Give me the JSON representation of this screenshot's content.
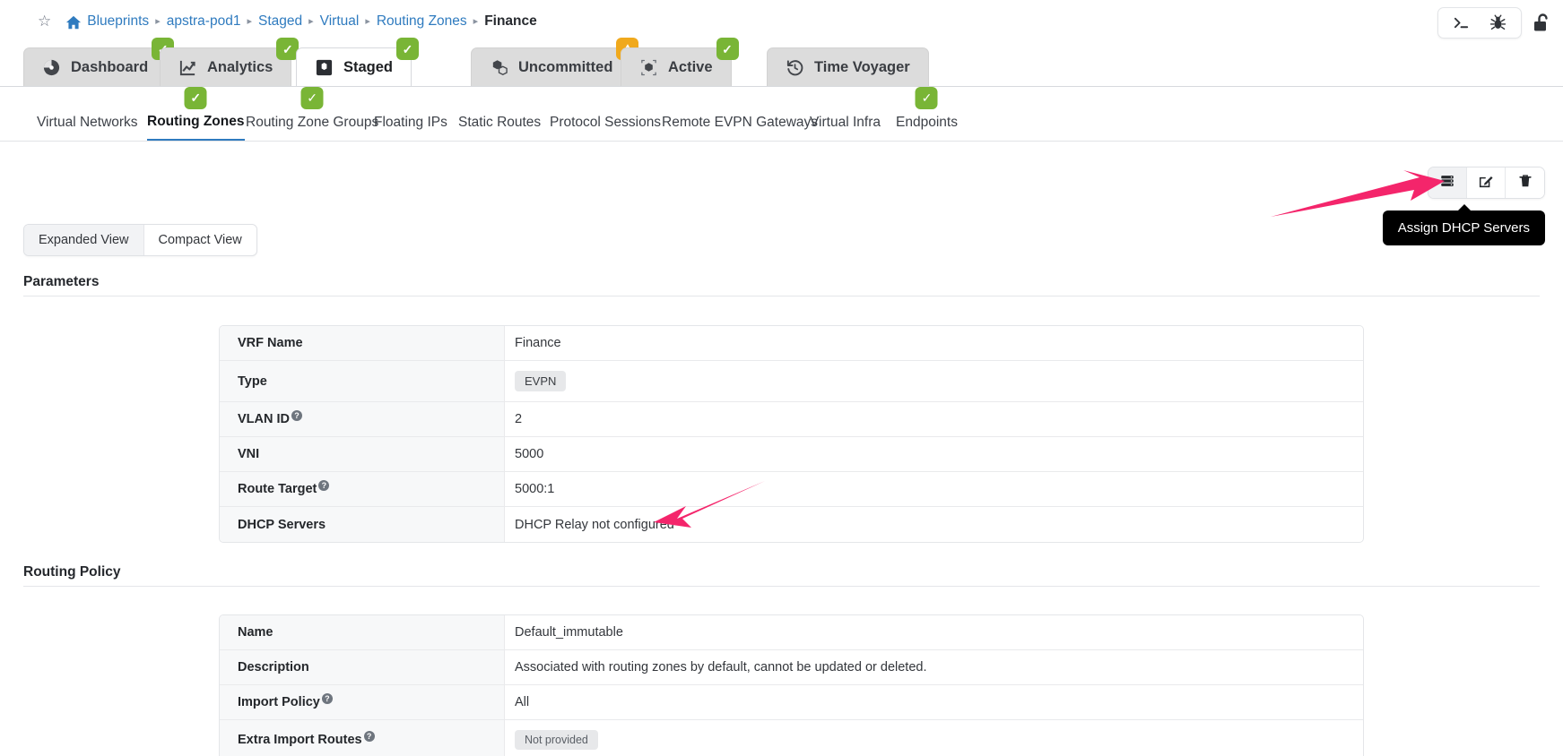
{
  "breadcrumb": {
    "items": [
      {
        "label": "Blueprints",
        "link": true
      },
      {
        "label": "apstra-pod1",
        "link": true
      },
      {
        "label": "Staged",
        "link": true
      },
      {
        "label": "Virtual",
        "link": true
      },
      {
        "label": "Routing Zones",
        "link": true
      },
      {
        "label": "Finance",
        "link": false
      }
    ],
    "separator": "▸"
  },
  "topbar": {
    "terminal_icon": "terminal-icon",
    "bug_icon": "bug-icon",
    "lock_icon": "unlocked-padlock-icon"
  },
  "tabs": [
    {
      "label": "Dashboard",
      "icon": "dashboard-gauge-icon",
      "badge": "ok",
      "selected": false
    },
    {
      "label": "Analytics",
      "icon": "analytics-chart-icon",
      "badge": "ok",
      "selected": false
    },
    {
      "label": "Staged",
      "icon": "staged-box-icon",
      "badge": "ok",
      "selected": true
    },
    {
      "label": "Uncommitted",
      "icon": "uncommitted-cubes-icon",
      "badge": "warn",
      "selected": false
    },
    {
      "label": "Active",
      "icon": "active-cube-icon",
      "badge": "ok",
      "selected": false
    },
    {
      "label": "Time Voyager",
      "icon": "time-voyager-clock-icon",
      "badge": null,
      "selected": false
    }
  ],
  "subtabs": [
    {
      "label": "Virtual Networks",
      "badge": false,
      "selected": false
    },
    {
      "label": "Routing Zones",
      "badge": true,
      "selected": true
    },
    {
      "label": "Routing Zone Groups",
      "badge": true,
      "selected": false
    },
    {
      "label": "Floating IPs",
      "badge": false,
      "selected": false
    },
    {
      "label": "Static Routes",
      "badge": false,
      "selected": false
    },
    {
      "label": "Protocol Sessions",
      "badge": false,
      "selected": false
    },
    {
      "label": "Remote EVPN Gateways",
      "badge": false,
      "selected": false
    },
    {
      "label": "Virtual Infra",
      "badge": false,
      "selected": false
    },
    {
      "label": "Endpoints",
      "badge": true,
      "selected": false
    }
  ],
  "actionbar": {
    "assign_dhcp": {
      "name": "assign-dhcp-servers-button",
      "icon": "server-stack-icon"
    },
    "edit": {
      "name": "edit-button",
      "icon": "pencil-square-icon"
    },
    "delete": {
      "name": "delete-button",
      "icon": "trash-icon"
    },
    "tooltip": "Assign DHCP Servers"
  },
  "view_switch": {
    "options": [
      {
        "label": "Expanded View",
        "selected": true
      },
      {
        "label": "Compact View",
        "selected": false
      }
    ]
  },
  "parameters": {
    "title": "Parameters",
    "rows": [
      {
        "key": "VRF Name",
        "help": false,
        "value": "Finance",
        "type": "text"
      },
      {
        "key": "Type",
        "help": false,
        "value": "EVPN",
        "type": "pill"
      },
      {
        "key": "VLAN ID",
        "help": true,
        "value": "2",
        "type": "text"
      },
      {
        "key": "VNI",
        "help": false,
        "value": "5000",
        "type": "text"
      },
      {
        "key": "Route Target",
        "help": true,
        "value": "5000:1",
        "type": "text"
      },
      {
        "key": "DHCP Servers",
        "help": false,
        "value": "DHCP Relay not configured",
        "type": "text"
      }
    ]
  },
  "routing_policy": {
    "title": "Routing Policy",
    "rows": [
      {
        "key": "Name",
        "help": false,
        "value": "Default_immutable",
        "type": "text"
      },
      {
        "key": "Description",
        "help": false,
        "value": "Associated with routing zones by default, cannot be updated or deleted.",
        "type": "text"
      },
      {
        "key": "Import Policy",
        "help": true,
        "value": "All",
        "type": "text"
      },
      {
        "key": "Extra Import Routes",
        "help": true,
        "value": "Not provided",
        "type": "pill"
      }
    ]
  },
  "annotations": {
    "arrow_color": "#f4256b",
    "arrow_to_toolbar": "points-right-to-assign-dhcp-button",
    "arrow_to_dhcp_value": "points-left-to-dhcp-relay-not-configured"
  },
  "colors": {
    "link": "#2f7bbf",
    "badge_ok": "#79b536",
    "badge_warn": "#f0a91d",
    "tooltip_bg": "#000000"
  }
}
